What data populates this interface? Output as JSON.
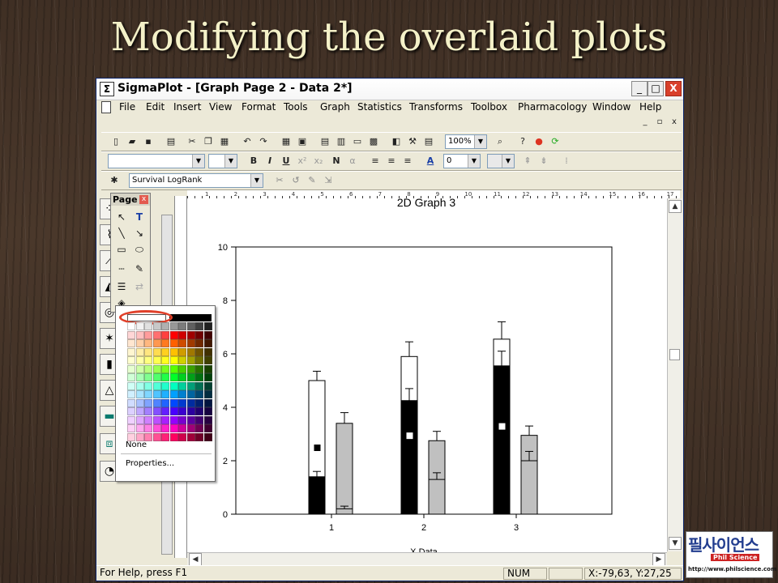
{
  "slide": {
    "title": "Modifying the overlaid plots"
  },
  "window": {
    "title": "SigmaPlot - [Graph Page 2 - Data 2*]",
    "minimize": "_",
    "maximize": "□",
    "close": "X"
  },
  "menu": {
    "items": [
      "File",
      "Edit",
      "Insert",
      "View",
      "Format",
      "Tools",
      "Graph",
      "Statistics",
      "Transforms",
      "Toolbox",
      "Pharmacology",
      "Window",
      "Help"
    ],
    "mdi_min": "_",
    "mdi_restore": "▫",
    "mdi_close": "x"
  },
  "toolbar": {
    "zoom": "100%",
    "line_width": "0",
    "macro": "Survival LogRank"
  },
  "format_toolbar": {
    "bold": "B",
    "italic": "I",
    "underline": "U",
    "normal": "N"
  },
  "ruler": {
    "top_ticks": [
      "1",
      "2",
      "3",
      "4",
      "5",
      "6",
      "7",
      "8",
      "9",
      "10",
      "11",
      "12",
      "13",
      "14",
      "15",
      "16",
      "17",
      "18"
    ]
  },
  "page_palette": {
    "title": "Page",
    "text_tool": "T"
  },
  "color_popup": {
    "none_label": "None",
    "properties_label": "Properties..."
  },
  "status": {
    "help": "For Help, press F1",
    "num": "NUM",
    "coords": "X:-79,63, Y:27,25"
  },
  "logo": {
    "korean": "필사이언스",
    "english": "Phil Science",
    "url": "http://www.philscience.com"
  },
  "chart_data": {
    "type": "bar",
    "title": "2D Graph 3",
    "xlabel": "X Data",
    "categories": [
      "1",
      "2",
      "3"
    ],
    "ylim": [
      0,
      10
    ],
    "yticks": [
      "0",
      "2",
      "4",
      "6",
      "8",
      "10"
    ],
    "series": [
      {
        "name": "",
        "values": [
          1.4,
          4.25,
          5.55
        ],
        "errors": [
          0.2,
          0.45,
          0.55
        ],
        "color": "#000000"
      },
      {
        "name": "",
        "values": [
          5.0,
          5.9,
          6.55
        ],
        "errors": [
          0.35,
          0.55,
          0.65
        ],
        "color": "#ffffff"
      },
      {
        "name": "",
        "values": [
          3.4,
          2.75,
          2.95
        ],
        "errors": [
          0.4,
          0.35,
          0.35
        ],
        "color": "#c0c0c0"
      },
      {
        "name": "",
        "values": [
          0.2,
          1.3,
          2.0
        ],
        "errors": [
          0.1,
          0.25,
          0.35
        ],
        "color": "#c0c0c0"
      }
    ],
    "markers": [
      2.5,
      2.95,
      3.3
    ],
    "grid": false
  }
}
